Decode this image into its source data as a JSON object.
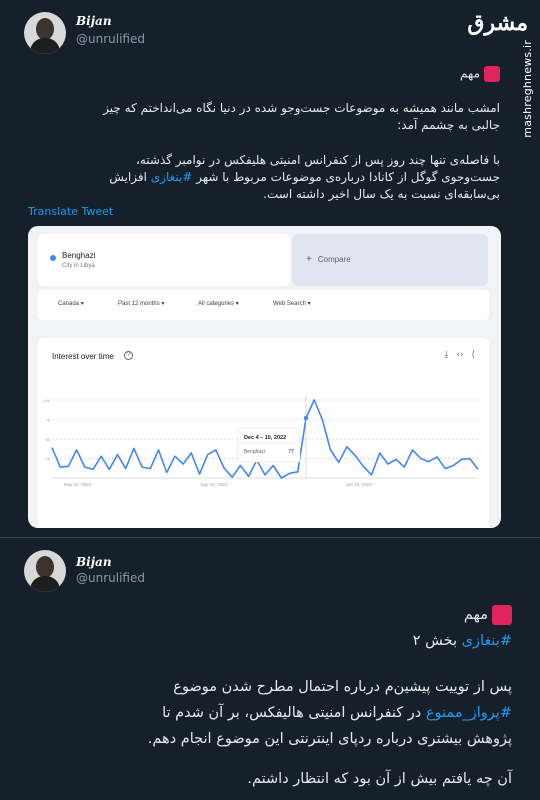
{
  "brand": {
    "logo": "مشرق",
    "url": "mashreghnews.ir"
  },
  "tweet1": {
    "author_name": "Bijan",
    "author_handle": "@unrulified",
    "label": "مهم",
    "para1": [
      "امشب مانند همیشه به موضوعات جست‌وجو شده در دنیا نگاه می‌انداختم که چیز",
      "جالبی به چشمم آمد:"
    ],
    "para2_line1": "با فاصله‌ی تنها چند روز پس از کنفرانس امنیتی هلیفکس در نوامبر گذشته،",
    "para2_line2_a": "جست‌وجوی گوگل از کانادا درباره‌ی موضوعات مربوط با شهر ",
    "para2_hashtag": "#بنغازی",
    "para2_line2_b": " افزایش",
    "para2_line3": "بی‌سابقه‌ای نسبت به یک سال اخیر داشته است.",
    "translate": "Translate Tweet"
  },
  "trends": {
    "term": "Benghazi",
    "term_sub": "City in Libya",
    "compare": "Compare",
    "filters": [
      "Canada",
      "Past 12 months",
      "All categories",
      "Web Search"
    ],
    "chart_title": "Interest over time",
    "help_icon": "?",
    "tool_icons": [
      "download-icon",
      "embed-icon",
      "share-icon"
    ],
    "tool_glyphs": [
      "⤓",
      "‹›",
      "⟨"
    ],
    "tooltip_date": "Dec 4 – 10, 2022",
    "tooltip_term": "Benghazi",
    "tooltip_value": "77",
    "line_color": "#4285f4"
  },
  "chart_data": {
    "type": "line",
    "title": "Interest over time",
    "x_ticks": [
      "May 22, 2022",
      "Sep 18, 2022",
      "Jan 15, 2023"
    ],
    "y_ticks": [
      100,
      75,
      50,
      25
    ],
    "ylim": [
      0,
      100
    ],
    "series": [
      {
        "name": "Benghazi",
        "values": [
          39,
          14,
          15,
          36,
          14,
          11,
          28,
          11,
          30,
          12,
          38,
          14,
          12,
          36,
          7,
          28,
          18,
          32,
          5,
          30,
          36,
          13,
          1,
          16,
          2,
          23,
          4,
          16,
          0,
          6,
          8,
          77,
          100,
          75,
          36,
          20,
          40,
          29,
          15,
          4,
          32,
          18,
          24,
          14,
          36,
          25,
          21,
          27,
          12,
          16,
          24,
          25,
          11
        ]
      }
    ]
  },
  "tweet2": {
    "author_name": "Bijan",
    "author_handle": "@unrulified",
    "label": "مهم",
    "hashtag_line_tag": "#بنغازی",
    "hashtag_line_rest": " بخش ۲",
    "p_line1": "پس از توییت پیشین‌م درباره احتمال مطرح شدن موضوع",
    "p_line2_tag": "#پرواز_ممنوع",
    "p_line2_rest": " در کنفرانس امنیتی هالیفکس، بر آن شدم تا",
    "p_line3": "پژوهش بیشتری درباره ردپای اینترنتی این موضوع انجام دهم.",
    "p_line4": "آن چه یافتم بیش از آن بود که انتظار داشتم."
  }
}
